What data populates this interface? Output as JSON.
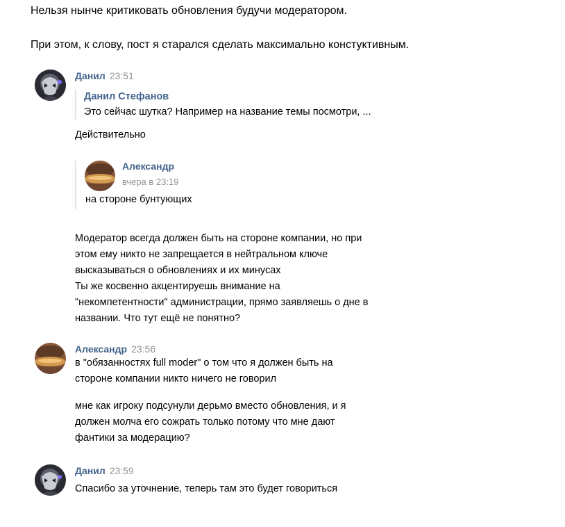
{
  "intro": {
    "line1": "Нельзя нынче критиковать обновления будучи модератором.",
    "line2": "При этом, к слову, пост я старался сделать максимально констуктивным."
  },
  "messages": [
    {
      "author": "Данил",
      "time": "23:51",
      "avatar_icon": "dark-character-avatar",
      "reply": {
        "author": "Данил Стефанов",
        "text": "Это сейчас шутка? Например на название темы посмотри, ..."
      },
      "text1": "Действительно",
      "quote": {
        "author": "Александр",
        "time": "вчера в 23:19",
        "text": "на стороне бунтующих",
        "avatar_icon": "warm-toned-avatar"
      },
      "lines": [
        "Модератор всегда должен быть на стороне компании, но при",
        "этом ему никто не запрещается в нейтральном ключе",
        "высказываться о обновлениях и их минусах",
        "Ты же косвенно акцентируешь внимание на",
        "\"некомпетентности\" администрации, прямо заявляешь о дне в",
        "названии. Что тут ещё не понятно?"
      ]
    },
    {
      "author": "Александр",
      "time": "23:56",
      "avatar_icon": "warm-toned-avatar",
      "lines": [
        "в \"обязанностях full moder\" о том что я должен быть на",
        "стороне компании никто ничего не говорил"
      ],
      "lines2": [
        "мне как игроку подсунули дерьмо вместо обновления, и я",
        "должен молча его сожрать только потому что мне дают",
        "фантики за модерацию?"
      ]
    },
    {
      "author": "Данил",
      "time": "23:59",
      "avatar_icon": "dark-character-avatar",
      "lines": [
        "Спасибо за уточнение, теперь там это будет говориться"
      ]
    }
  ],
  "colors": {
    "name": "#42648b",
    "time": "#939393",
    "reply_border": "#dfe4ea",
    "text": "#000000"
  }
}
